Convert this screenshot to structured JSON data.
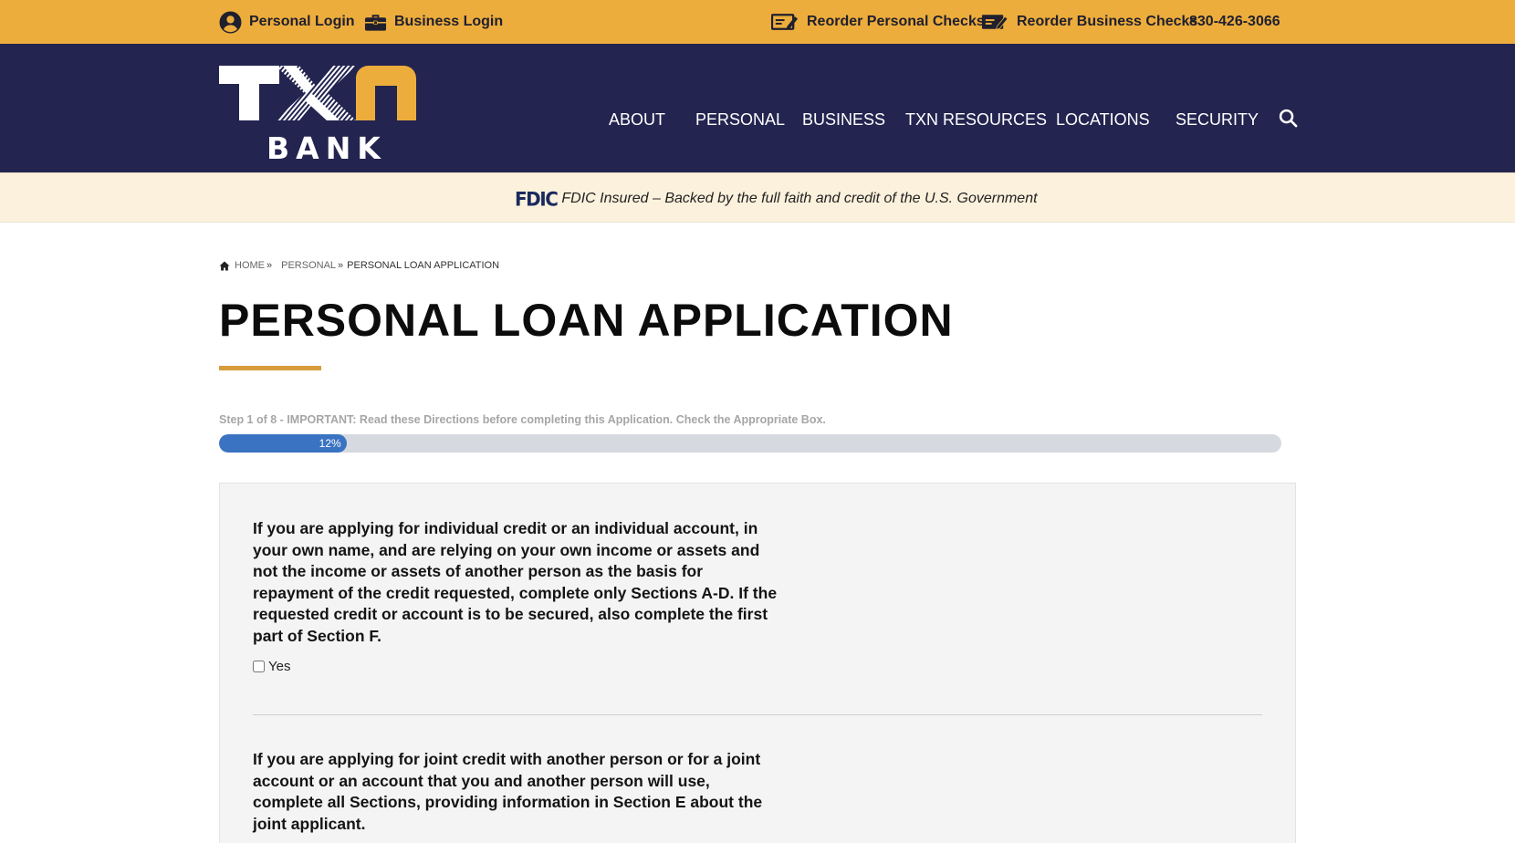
{
  "topbar": {
    "personal_login": "Personal Login",
    "business_login": "Business Login",
    "reorder_personal": "Reorder Personal Checks",
    "reorder_business": "Reorder Business Checks",
    "phone": "830-426-3066"
  },
  "logo": {
    "mark": "TXN",
    "word": "BANK"
  },
  "nav": {
    "items": [
      "ABOUT",
      "PERSONAL",
      "BUSINESS",
      "TXN RESOURCES",
      "LOCATIONS",
      "SECURITY"
    ]
  },
  "fdic": {
    "logo": "FDIC",
    "text": "FDIC Insured – Backed by the full faith and credit of the U.S. Government"
  },
  "breadcrumb": {
    "home": "HOME",
    "personal": "PERSONAL",
    "current": "PERSONAL LOAN APPLICATION",
    "separator": "»"
  },
  "page_title": "PERSONAL LOAN APPLICATION",
  "progress": {
    "step_text": "Step 1 of 8 - IMPORTANT: Read these Directions before completing this Application. Check the Appropriate Box.",
    "percent": 12,
    "label": "12%"
  },
  "form": {
    "question1": "If you are applying for individual credit or an individual account, in your own name, and are relying on your own income or assets and not the income or assets of another person as the basis for repayment of the credit requested, complete only Sections A-D. If the requested credit or account is to be secured, also complete the first part of Section F.",
    "option_yes": "Yes",
    "question2": "If you are applying for joint credit with another person or for a joint account or an account that you and another person will use, complete all Sections, providing information in Section E about the joint applicant."
  },
  "colors": {
    "topbar": "#edad3c",
    "nav": "#232450",
    "accent": "#d79c3c",
    "progress": "#3a73c2"
  }
}
